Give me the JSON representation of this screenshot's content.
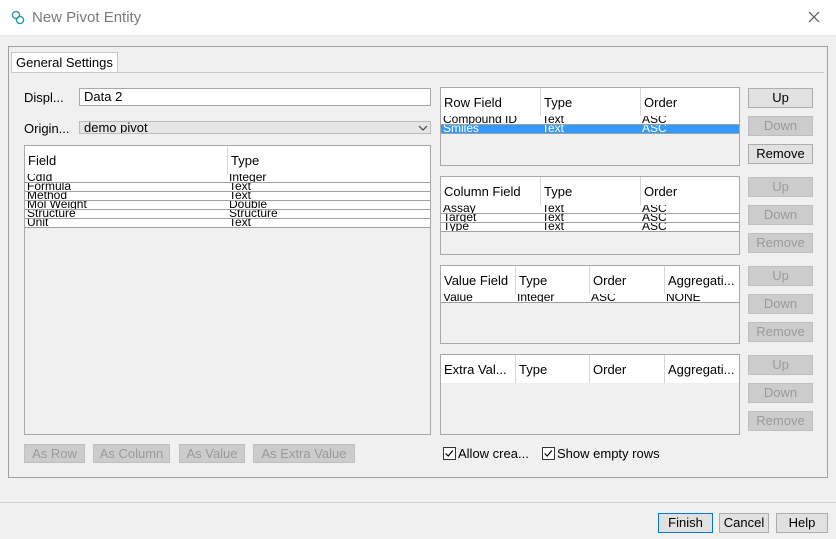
{
  "window": {
    "title": "New Pivot Entity",
    "close_icon": "close-icon"
  },
  "tab": {
    "label": "General Settings"
  },
  "display": {
    "label": "Displ...",
    "value": "Data 2"
  },
  "origin": {
    "label": "Origin...",
    "value": "demo pivot"
  },
  "fields_table": {
    "headers": [
      "Field",
      "Type"
    ],
    "rows": [
      [
        "CdId",
        "Integer"
      ],
      [
        "Formula",
        "Text"
      ],
      [
        "Method",
        "Text"
      ],
      [
        "Mol Weight",
        "Double"
      ],
      [
        "Structure",
        "Structure"
      ],
      [
        "Unit",
        "Text"
      ]
    ]
  },
  "row_table": {
    "headers": [
      "Row Field",
      "Type",
      "Order"
    ],
    "rows": [
      [
        "Compound ID",
        "Text",
        "ASC"
      ],
      [
        "Smiles",
        "Text",
        "ASC"
      ]
    ]
  },
  "column_table": {
    "headers": [
      "Column Field",
      "Type",
      "Order"
    ],
    "rows": [
      [
        "Assay",
        "Text",
        "ASC"
      ],
      [
        "Target",
        "Text",
        "ASC"
      ],
      [
        "Type",
        "Text",
        "ASC"
      ]
    ]
  },
  "value_table": {
    "headers": [
      "Value Field",
      "Type",
      "Order",
      "Aggregati..."
    ],
    "rows": [
      [
        "Value",
        "Integer",
        "ASC",
        "NONE"
      ]
    ]
  },
  "extra_table": {
    "headers": [
      "Extra Val...",
      "Type",
      "Order",
      "Aggregati..."
    ],
    "rows": []
  },
  "side_buttons": {
    "up": "Up",
    "down": "Down",
    "remove": "Remove"
  },
  "assign_buttons": {
    "as_row": "As Row",
    "as_column": "As Column",
    "as_value": "As Value",
    "as_extra": "As Extra Value"
  },
  "checkboxes": {
    "allow_create": "Allow crea...",
    "show_empty": "Show empty rows"
  },
  "footer": {
    "finish": "Finish",
    "cancel": "Cancel",
    "help": "Help"
  },
  "colors": {
    "selection": "#3399ff",
    "primary_border": "#0078d7"
  }
}
